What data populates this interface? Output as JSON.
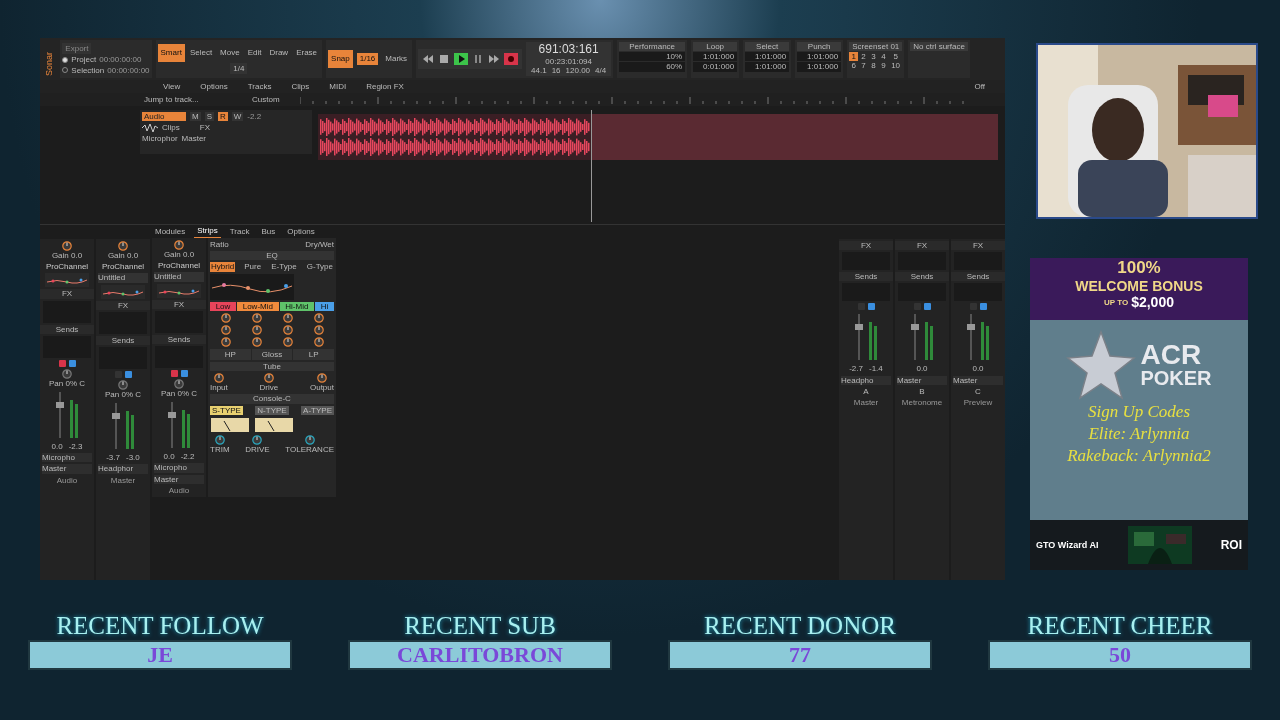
{
  "daw": {
    "app": "Sonar",
    "export": "Export",
    "clock_rows": [
      {
        "label": "Project",
        "time": "00:00:00:00",
        "selected": true
      },
      {
        "label": "Selection",
        "time": "00:00:00:00",
        "selected": false
      }
    ],
    "tools": [
      {
        "label": "Smart",
        "selected": true
      },
      {
        "label": "Select",
        "selected": false
      },
      {
        "label": "Move",
        "selected": false
      },
      {
        "label": "Edit",
        "selected": false
      },
      {
        "label": "Draw",
        "selected": false
      },
      {
        "label": "Erase",
        "selected": false
      }
    ],
    "grid_value": "1/4",
    "snap": {
      "label": "Snap",
      "on": true,
      "value": "1/16"
    },
    "marks": "Marks",
    "time": "691:03:161",
    "time_sub": "00:23:01:094",
    "sample_rate": "44.1",
    "bit_depth": "16",
    "tempo": "120.00",
    "meter": "4/4",
    "performance": {
      "title": "Performance",
      "readings": [
        "10%",
        "60%"
      ]
    },
    "modules": [
      {
        "title": "Loop",
        "values": [
          "1:01:000",
          "0:01:000"
        ]
      },
      {
        "title": "Select",
        "values": [
          "1:01:000",
          "1:01:000"
        ]
      },
      {
        "title": "Punch",
        "values": [
          "1:01:000",
          "1:01:000"
        ]
      }
    ],
    "screenset": {
      "title": "Screenset 01",
      "slots": [
        {
          "label": "1",
          "selected": true
        },
        {
          "label": "2",
          "selected": false
        },
        {
          "label": "3",
          "selected": false
        },
        {
          "label": "4",
          "selected": false
        },
        {
          "label": "5",
          "selected": false
        },
        {
          "label": "6",
          "selected": false
        },
        {
          "label": "7",
          "selected": false
        },
        {
          "label": "8",
          "selected": false
        },
        {
          "label": "9",
          "selected": false
        },
        {
          "label": "10",
          "selected": false
        }
      ]
    },
    "ctrl_surface": "No ctrl surface",
    "xray": "Off",
    "menu": [
      "View",
      "Options",
      "Tracks",
      "Clips",
      "MIDI",
      "Region FX"
    ],
    "jump": "Jump to track...",
    "view_preset": "Custom",
    "track": {
      "name": "Audio",
      "volume": "-2.2",
      "lane": "Clips",
      "input": "Microphor",
      "output": "Master",
      "fx": "FX",
      "buttons": [
        {
          "label": "M",
          "on": false
        },
        {
          "label": "S",
          "on": false
        },
        {
          "label": "R",
          "on": true
        },
        {
          "label": "W",
          "on": false
        }
      ]
    },
    "console_tabs": [
      {
        "label": "Modules",
        "selected": false
      },
      {
        "label": "Strips",
        "selected": true
      },
      {
        "label": "Track",
        "selected": false
      },
      {
        "label": "Bus",
        "selected": false
      },
      {
        "label": "Options",
        "selected": false
      }
    ],
    "left_strips": [
      {
        "gain": "Gain 0.0",
        "prochannel": "ProChannel",
        "fx": "FX",
        "sends": "Sends",
        "armed": true,
        "pan": "Pan 0% C",
        "readings": [
          "0.0",
          "-2.3"
        ],
        "input": "Micropho",
        "output": "Master",
        "name": "Audio"
      },
      {
        "gain": "Gain 0.0",
        "prochannel": "ProChannel",
        "preset": "Untitled",
        "fx": "FX",
        "sends": "Sends",
        "armed": false,
        "pan": "Pan 0% C",
        "readings": [
          "-3.7",
          "-3.0"
        ],
        "input": "Headphor",
        "name": "Master"
      }
    ],
    "focus_strip": {
      "gain": "Gain 0.0",
      "prochannel": "ProChannel",
      "preset": "Untitled",
      "fx": "FX",
      "sends": "Sends",
      "armed": true,
      "pan": "Pan 0% C",
      "readings": [
        "0.0",
        "-2.2"
      ],
      "input": "Micropho",
      "output": "Master",
      "name": "Audio"
    },
    "prochannel": {
      "top": [
        "Ratio",
        "Dry/Wet"
      ],
      "eq": "EQ",
      "modes": [
        {
          "label": "Hybrid",
          "selected": true
        },
        {
          "label": "Pure",
          "selected": false
        },
        {
          "label": "E-Type",
          "selected": false
        },
        {
          "label": "G-Type",
          "selected": false
        }
      ],
      "bands": [
        {
          "label": "Low",
          "color": "#e8445a"
        },
        {
          "label": "Low-Mid",
          "color": "#f08a3c"
        },
        {
          "label": "Hi-Mid",
          "color": "#5fc26a"
        },
        {
          "label": "Hi",
          "color": "#4a9fe8"
        }
      ],
      "filters": [
        "HP",
        "Gloss",
        "LP"
      ],
      "tube": "Tube",
      "tube_knobs": [
        "Input",
        "Drive",
        "Output"
      ],
      "console": "Console-C",
      "types": [
        {
          "label": "S-TYPE",
          "selected": true
        },
        {
          "label": "N-TYPE",
          "selected": false
        },
        {
          "label": "A-TYPE",
          "selected": false
        }
      ],
      "console_knobs": [
        "TRIM",
        "DRIVE",
        "TOLERANCE"
      ]
    },
    "right_strips": [
      {
        "fx": "FX",
        "sends": "Sends",
        "armed": false,
        "readings": [
          "-2.7",
          "-1.4"
        ],
        "input": "Headpho",
        "name": "Master",
        "letter": "A"
      },
      {
        "fx": "FX",
        "sends": "Sends",
        "armed": false,
        "readings": [
          "0.0"
        ],
        "input": "Master",
        "name": "Metronome",
        "letter": "B"
      },
      {
        "fx": "FX",
        "sends": "Sends",
        "armed": false,
        "readings": [
          "0.0"
        ],
        "input": "Master",
        "name": "Preview",
        "letter": "C"
      }
    ]
  },
  "ad": {
    "bonus": [
      "100%",
      "WELCOME BONUS",
      "UP TO",
      "$2,000"
    ],
    "brand": [
      "ACR",
      "POKER"
    ],
    "codes": [
      "Sign Up Codes",
      "Elite: Arlynnia",
      "Rakeback: Arlynnia2"
    ],
    "banner": {
      "headline": "GTO Wizard AI",
      "badge": "ROI"
    }
  },
  "stats": [
    {
      "label": "RECENT FOLLOW",
      "value": "JE"
    },
    {
      "label": "RECENT SUB",
      "value": "CARLITOBRON"
    },
    {
      "label": "RECENT DONOR",
      "value": "77"
    },
    {
      "label": "RECENT CHEER",
      "value": "50"
    }
  ]
}
